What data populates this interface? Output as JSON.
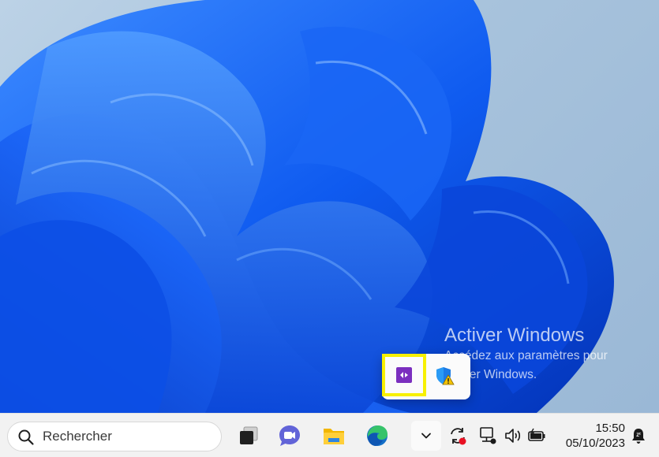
{
  "desktop": {
    "wallpaper": "windows-11-bloom",
    "watermark": {
      "title": "Activer Windows",
      "line1": "Accédez aux paramètres pour",
      "line2": "activer Windows."
    }
  },
  "tray_flyout": {
    "items": [
      {
        "name": "purple-app-icon",
        "highlighted": true
      },
      {
        "name": "windows-security-warning-icon",
        "highlighted": false
      }
    ],
    "highlight_color": "#f7f000"
  },
  "taskbar": {
    "search": {
      "placeholder": "Rechercher",
      "value": ""
    },
    "apps": [
      "task-view-icon",
      "teams-chat-icon",
      "file-explorer-icon",
      "edge-icon"
    ],
    "tray": [
      "show-hidden-icons-chevron",
      "sync-error-icon",
      "network-icon",
      "volume-icon",
      "battery-icon"
    ],
    "clock": {
      "time": "15:50",
      "date": "05/10/2023"
    },
    "notification": "notification-bell-icon"
  },
  "colors": {
    "accent": "#0067c0",
    "taskbar_bg": "#f2f2f2",
    "wallpaper_blue": "#0a4fe0"
  }
}
